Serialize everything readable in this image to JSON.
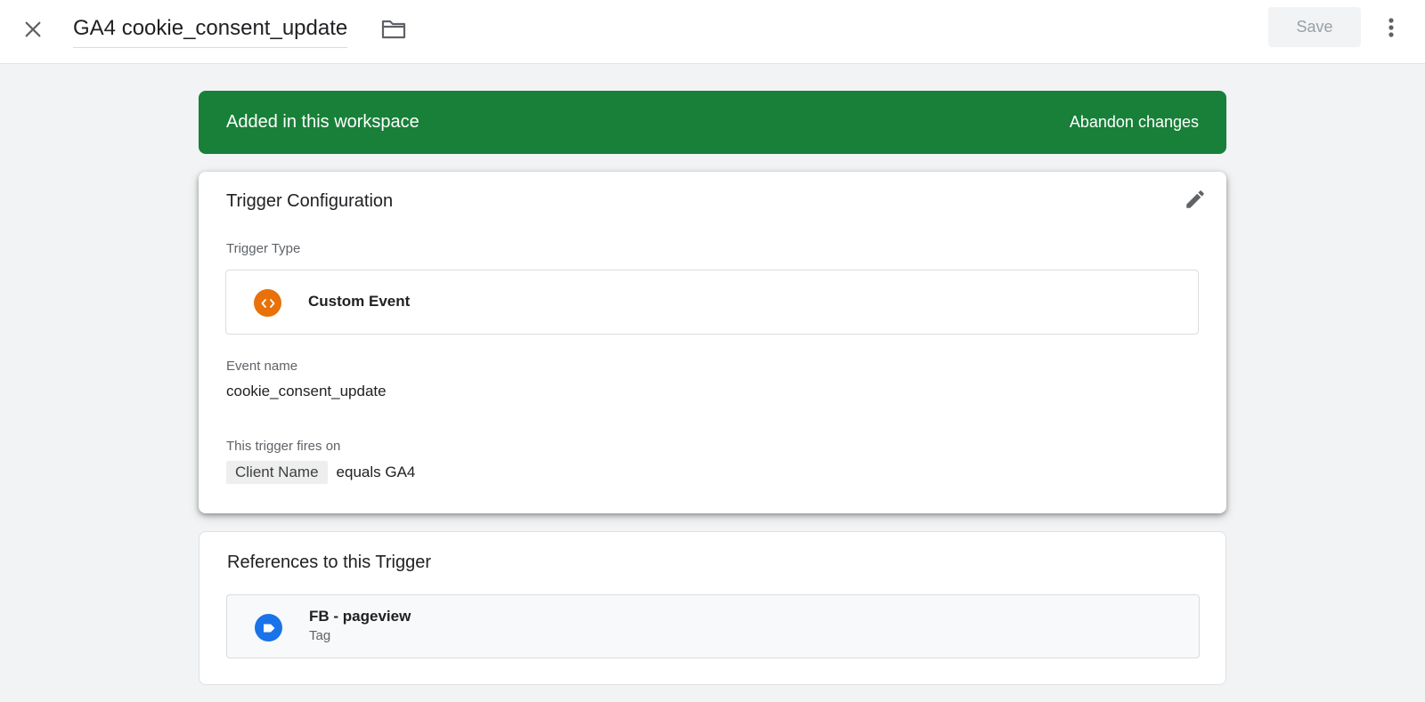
{
  "header": {
    "title": "GA4 cookie_consent_update",
    "save_label": "Save"
  },
  "banner": {
    "text": "Added in this workspace",
    "action_label": "Abandon changes",
    "color": "#188038"
  },
  "config": {
    "title": "Trigger Configuration",
    "trigger_type_label": "Trigger Type",
    "trigger_type": "Custom Event",
    "trigger_icon_color": "#e8710a",
    "event_name_label": "Event name",
    "event_name": "cookie_consent_update",
    "fires_on_label": "This trigger fires on",
    "condition": {
      "variable": "Client Name",
      "operator_value": "equals GA4"
    }
  },
  "references": {
    "title": "References to this Trigger",
    "items": [
      {
        "name": "FB - pageview",
        "type": "Tag",
        "icon_color": "#1a73e8"
      }
    ]
  },
  "icons": [
    "close-icon",
    "folder-icon",
    "more-vert-icon",
    "pencil-icon",
    "code-brackets-icon",
    "tag-icon"
  ]
}
